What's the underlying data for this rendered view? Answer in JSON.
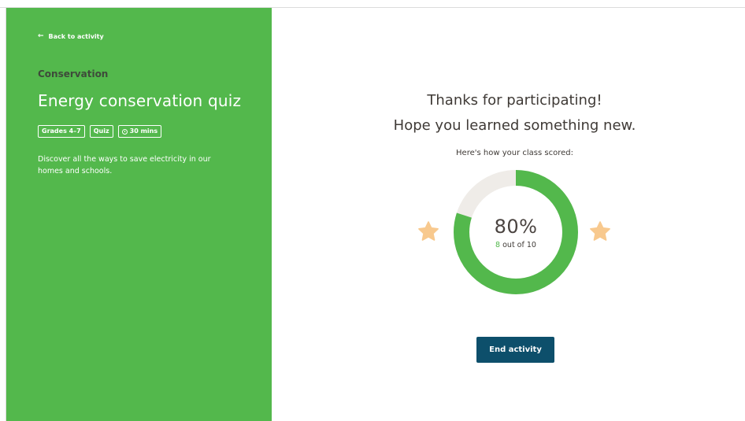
{
  "sidebar": {
    "back_label": "Back to activity",
    "category": "Conservation",
    "title": "Energy conservation quiz",
    "tags": [
      "Grades 4–7",
      "Quiz",
      "30 mins"
    ],
    "description": "Discover all the ways to save electricity in our homes and schools."
  },
  "result": {
    "line1": "Thanks for participating!",
    "line2": "Hope you learned something new.",
    "scored_label": "Here's how your class scored:",
    "percent_label": "80%",
    "score_fraction": 0.8,
    "correct": "8",
    "out_of_text": "out of 10"
  },
  "actions": {
    "end_label": "End activity"
  },
  "colors": {
    "brand_green": "#53b84c",
    "track": "#efece8",
    "star": "#f8c98e",
    "button": "#0d4f6b"
  }
}
